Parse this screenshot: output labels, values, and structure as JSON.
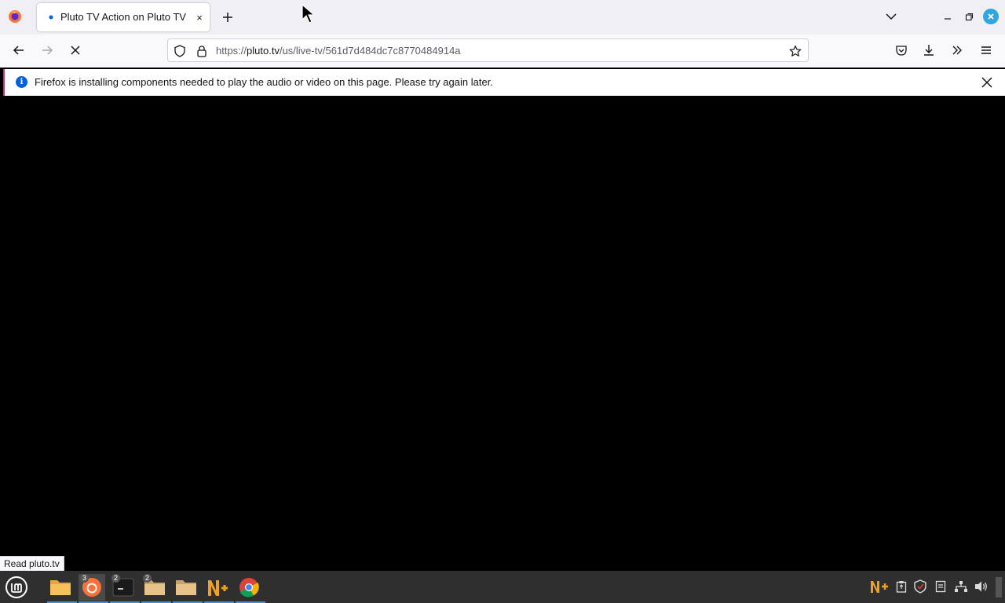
{
  "browser": {
    "tab": {
      "title": "Pluto TV Action on Pluto TV",
      "close": "×"
    },
    "url": {
      "scheme": "https://",
      "host": "pluto.tv",
      "path": "/us/live-tv/561d7d484dc7c8770484914a"
    },
    "notification": "Firefox is installing components needed to play the audio or video on this page. Please try again later.",
    "status_text": "Read pluto.tv"
  },
  "taskbar": {
    "badges": {
      "firefox": "3",
      "terminal": "2",
      "files": "2"
    }
  },
  "colors": {
    "accent": "#0060df",
    "window_close": "#2fa6e0",
    "content_bg": "#000000",
    "taskbar_bg": "#2f2f2f"
  }
}
